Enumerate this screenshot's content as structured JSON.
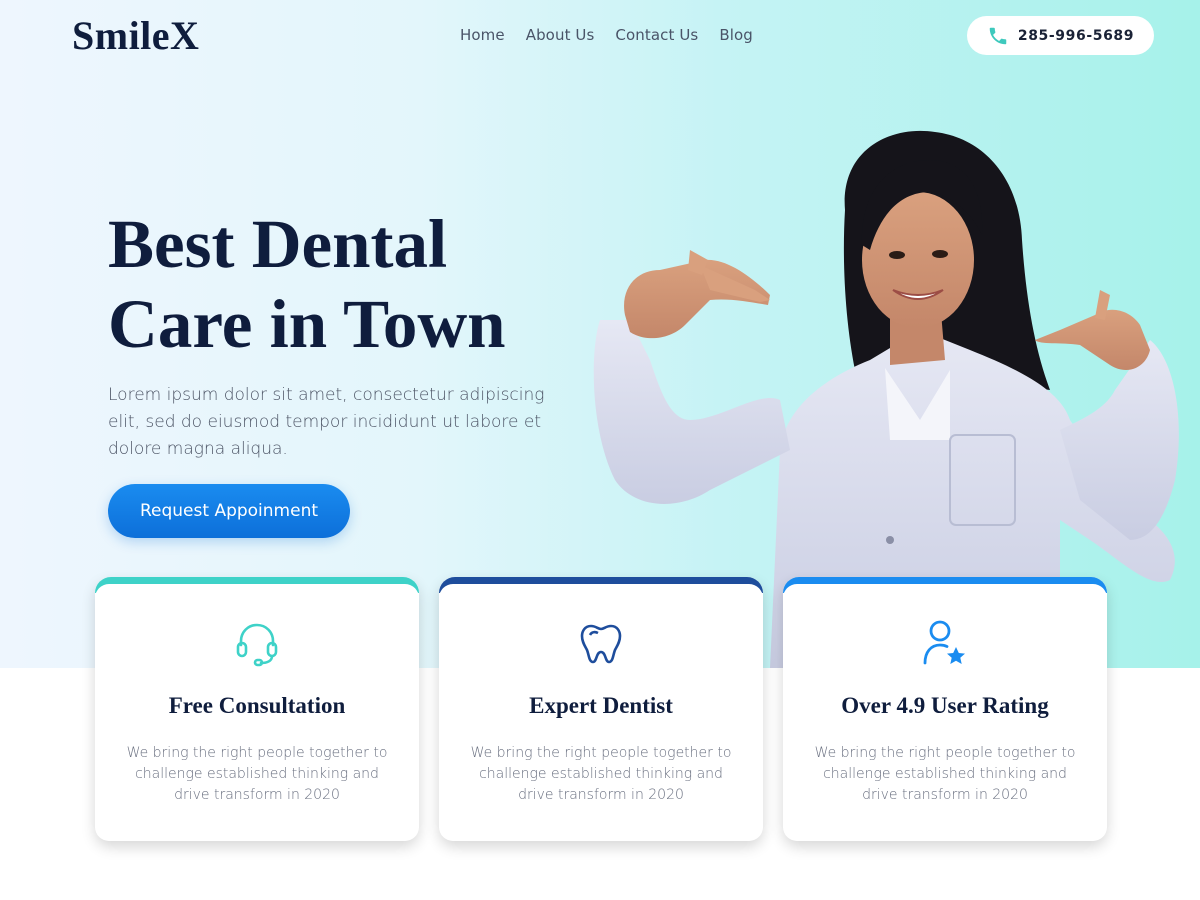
{
  "brand": {
    "logo": "SmileX"
  },
  "nav": {
    "items": [
      {
        "label": "Home"
      },
      {
        "label": "About Us"
      },
      {
        "label": "Contact Us"
      },
      {
        "label": "Blog"
      }
    ]
  },
  "header": {
    "phone": "285-996-5689",
    "phone_icon": "phone-icon"
  },
  "hero": {
    "title": "Best Dental Care in Town",
    "description": "Lorem ipsum dolor sit amet, consectetur adipiscing elit, sed do eiusmod tempor incididunt ut labore et dolore magna aliqua.",
    "cta_label": "Request Appoinment"
  },
  "features": [
    {
      "icon": "headset-icon",
      "accent": "#3ed2c8",
      "title": "Free Consultation",
      "text": "We bring the right people together to challenge established thinking and drive transform in 2020"
    },
    {
      "icon": "tooth-icon",
      "accent": "#1e4d9c",
      "title": "Expert Dentist",
      "text": "We bring the right people together to challenge established thinking and drive transform in 2020"
    },
    {
      "icon": "user-star-icon",
      "accent": "#1a8cf0",
      "title": "Over 4.9 User Rating",
      "text": "We bring the right people together to challenge established thinking and drive transform in 2020"
    }
  ],
  "colors": {
    "primary": "#0f1d3d",
    "accent_blue": "#1a8cf0",
    "accent_teal": "#3ed2c8",
    "hero_gradient_start": "#eef6fe",
    "hero_gradient_end": "#a6f2ea"
  }
}
